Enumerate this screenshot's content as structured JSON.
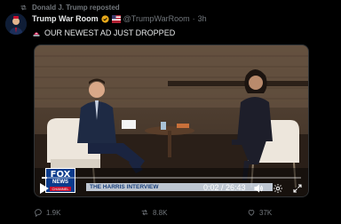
{
  "repost_line": {
    "text": "Donald J. Trump reposted"
  },
  "post": {
    "author_name": "Trump War Room",
    "handle": "@TrumpWarRoom",
    "separator": "·",
    "time": "3h",
    "text": "OUR NEWEST AD JUST DROPPED"
  },
  "video": {
    "timecode": "0:02 / 26:43",
    "progress": 0.02,
    "network_logo": {
      "line1": "FOX",
      "line2": "NEWS",
      "line3": "CHANNEL"
    },
    "ticker": "THE HARRIS INTERVIEW"
  },
  "actions": {
    "replies": "1.9K",
    "reposts": "8.8K",
    "likes": "37K"
  },
  "colors": {
    "muted": "#71767b",
    "text": "#e7e9ea",
    "background": "#000000"
  },
  "icons": [
    "repost-icon",
    "verified-badge-icon",
    "flag-icon",
    "siren-icon",
    "play-icon",
    "volume-icon",
    "settings-gear-icon",
    "expand-icon",
    "reply-icon",
    "like-icon"
  ]
}
